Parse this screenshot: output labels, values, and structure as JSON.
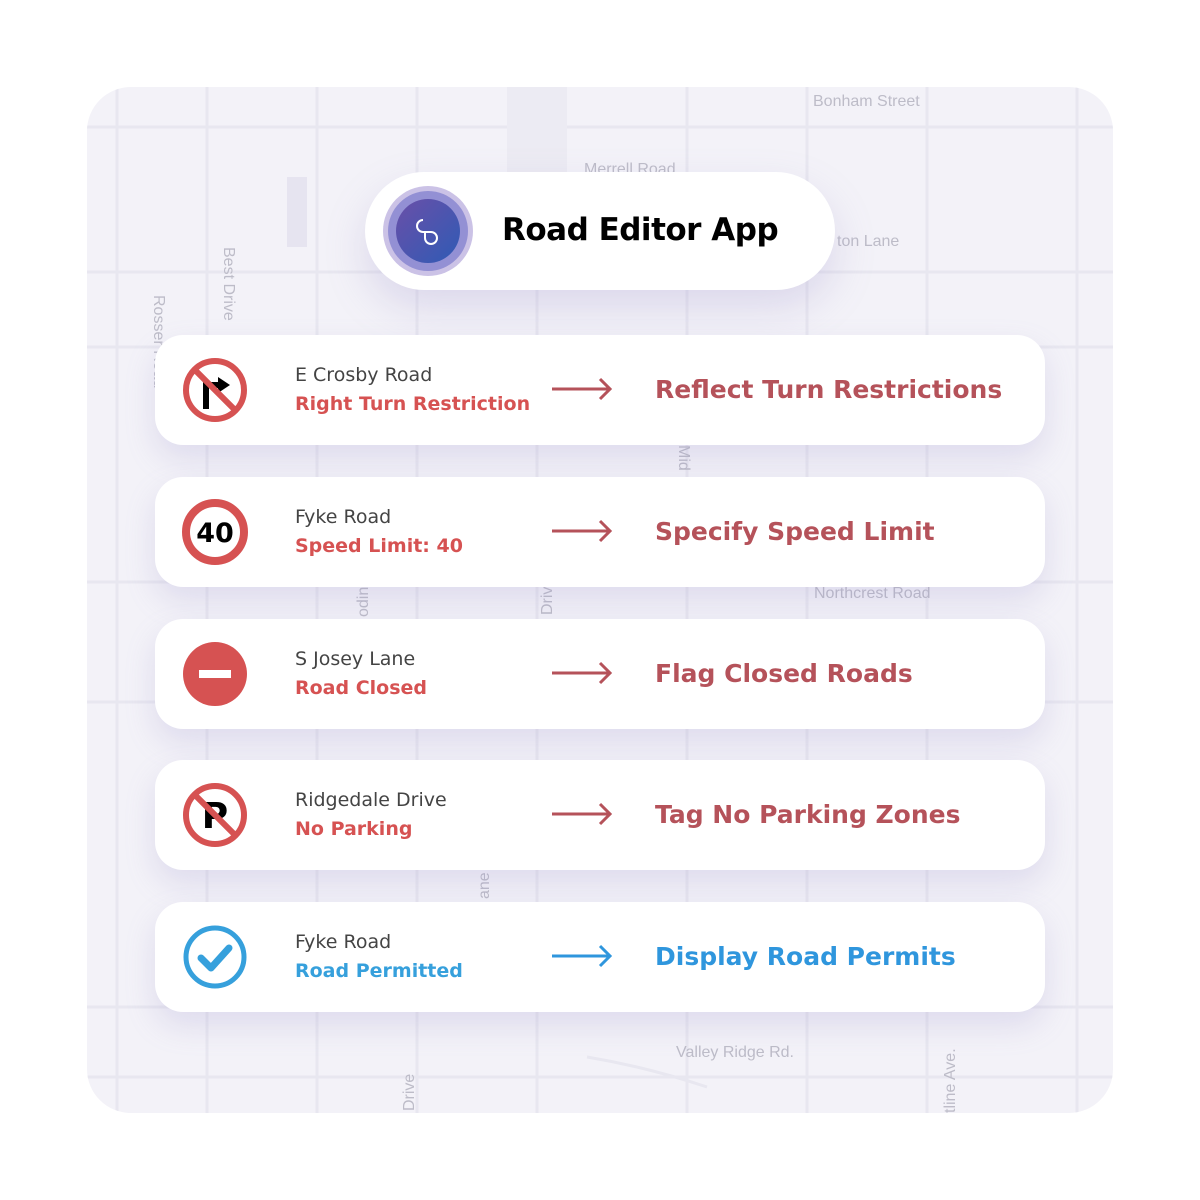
{
  "app": {
    "title": "Road Editor App",
    "logo_icon": "infinity-link-icon"
  },
  "map_labels": {
    "bonham": "Bonham Street",
    "merrell": "Merrell Road",
    "ton_lane": "ton Lane",
    "best_drive": "Best Drive",
    "rosser": "Rosser Road",
    "northcrest": "Northcrest Road",
    "valley": "Valley Ridge Rd.",
    "drive": "Drive",
    "line_ave": "tline Ave.",
    "lane": "ane",
    "mid": "Mid",
    "odin": "odin",
    "driv": "Driv"
  },
  "colors": {
    "red_status": "#d65252",
    "red_action": "#b5525a",
    "blue_status": "#36a0dc",
    "blue_action": "#2f96dd"
  },
  "rules": [
    {
      "icon": "no-right-turn-icon",
      "road": "E Crosby Road",
      "status": "Right Turn Restriction",
      "action": "Reflect Turn Restrictions",
      "theme": "red"
    },
    {
      "icon": "speed-limit-icon",
      "sign_text": "40",
      "road": "Fyke Road",
      "status": "Speed Limit: 40",
      "action": "Specify Speed Limit",
      "theme": "red"
    },
    {
      "icon": "no-entry-icon",
      "road": "S Josey Lane",
      "status": "Road Closed",
      "action": "Flag Closed Roads",
      "theme": "red"
    },
    {
      "icon": "no-parking-icon",
      "road": "Ridgedale Drive",
      "status": "No Parking",
      "action": "Tag No Parking Zones",
      "theme": "red"
    },
    {
      "icon": "check-circle-icon",
      "road": "Fyke Road",
      "status": "Road Permitted",
      "action": "Display Road Permits",
      "theme": "blue"
    }
  ]
}
